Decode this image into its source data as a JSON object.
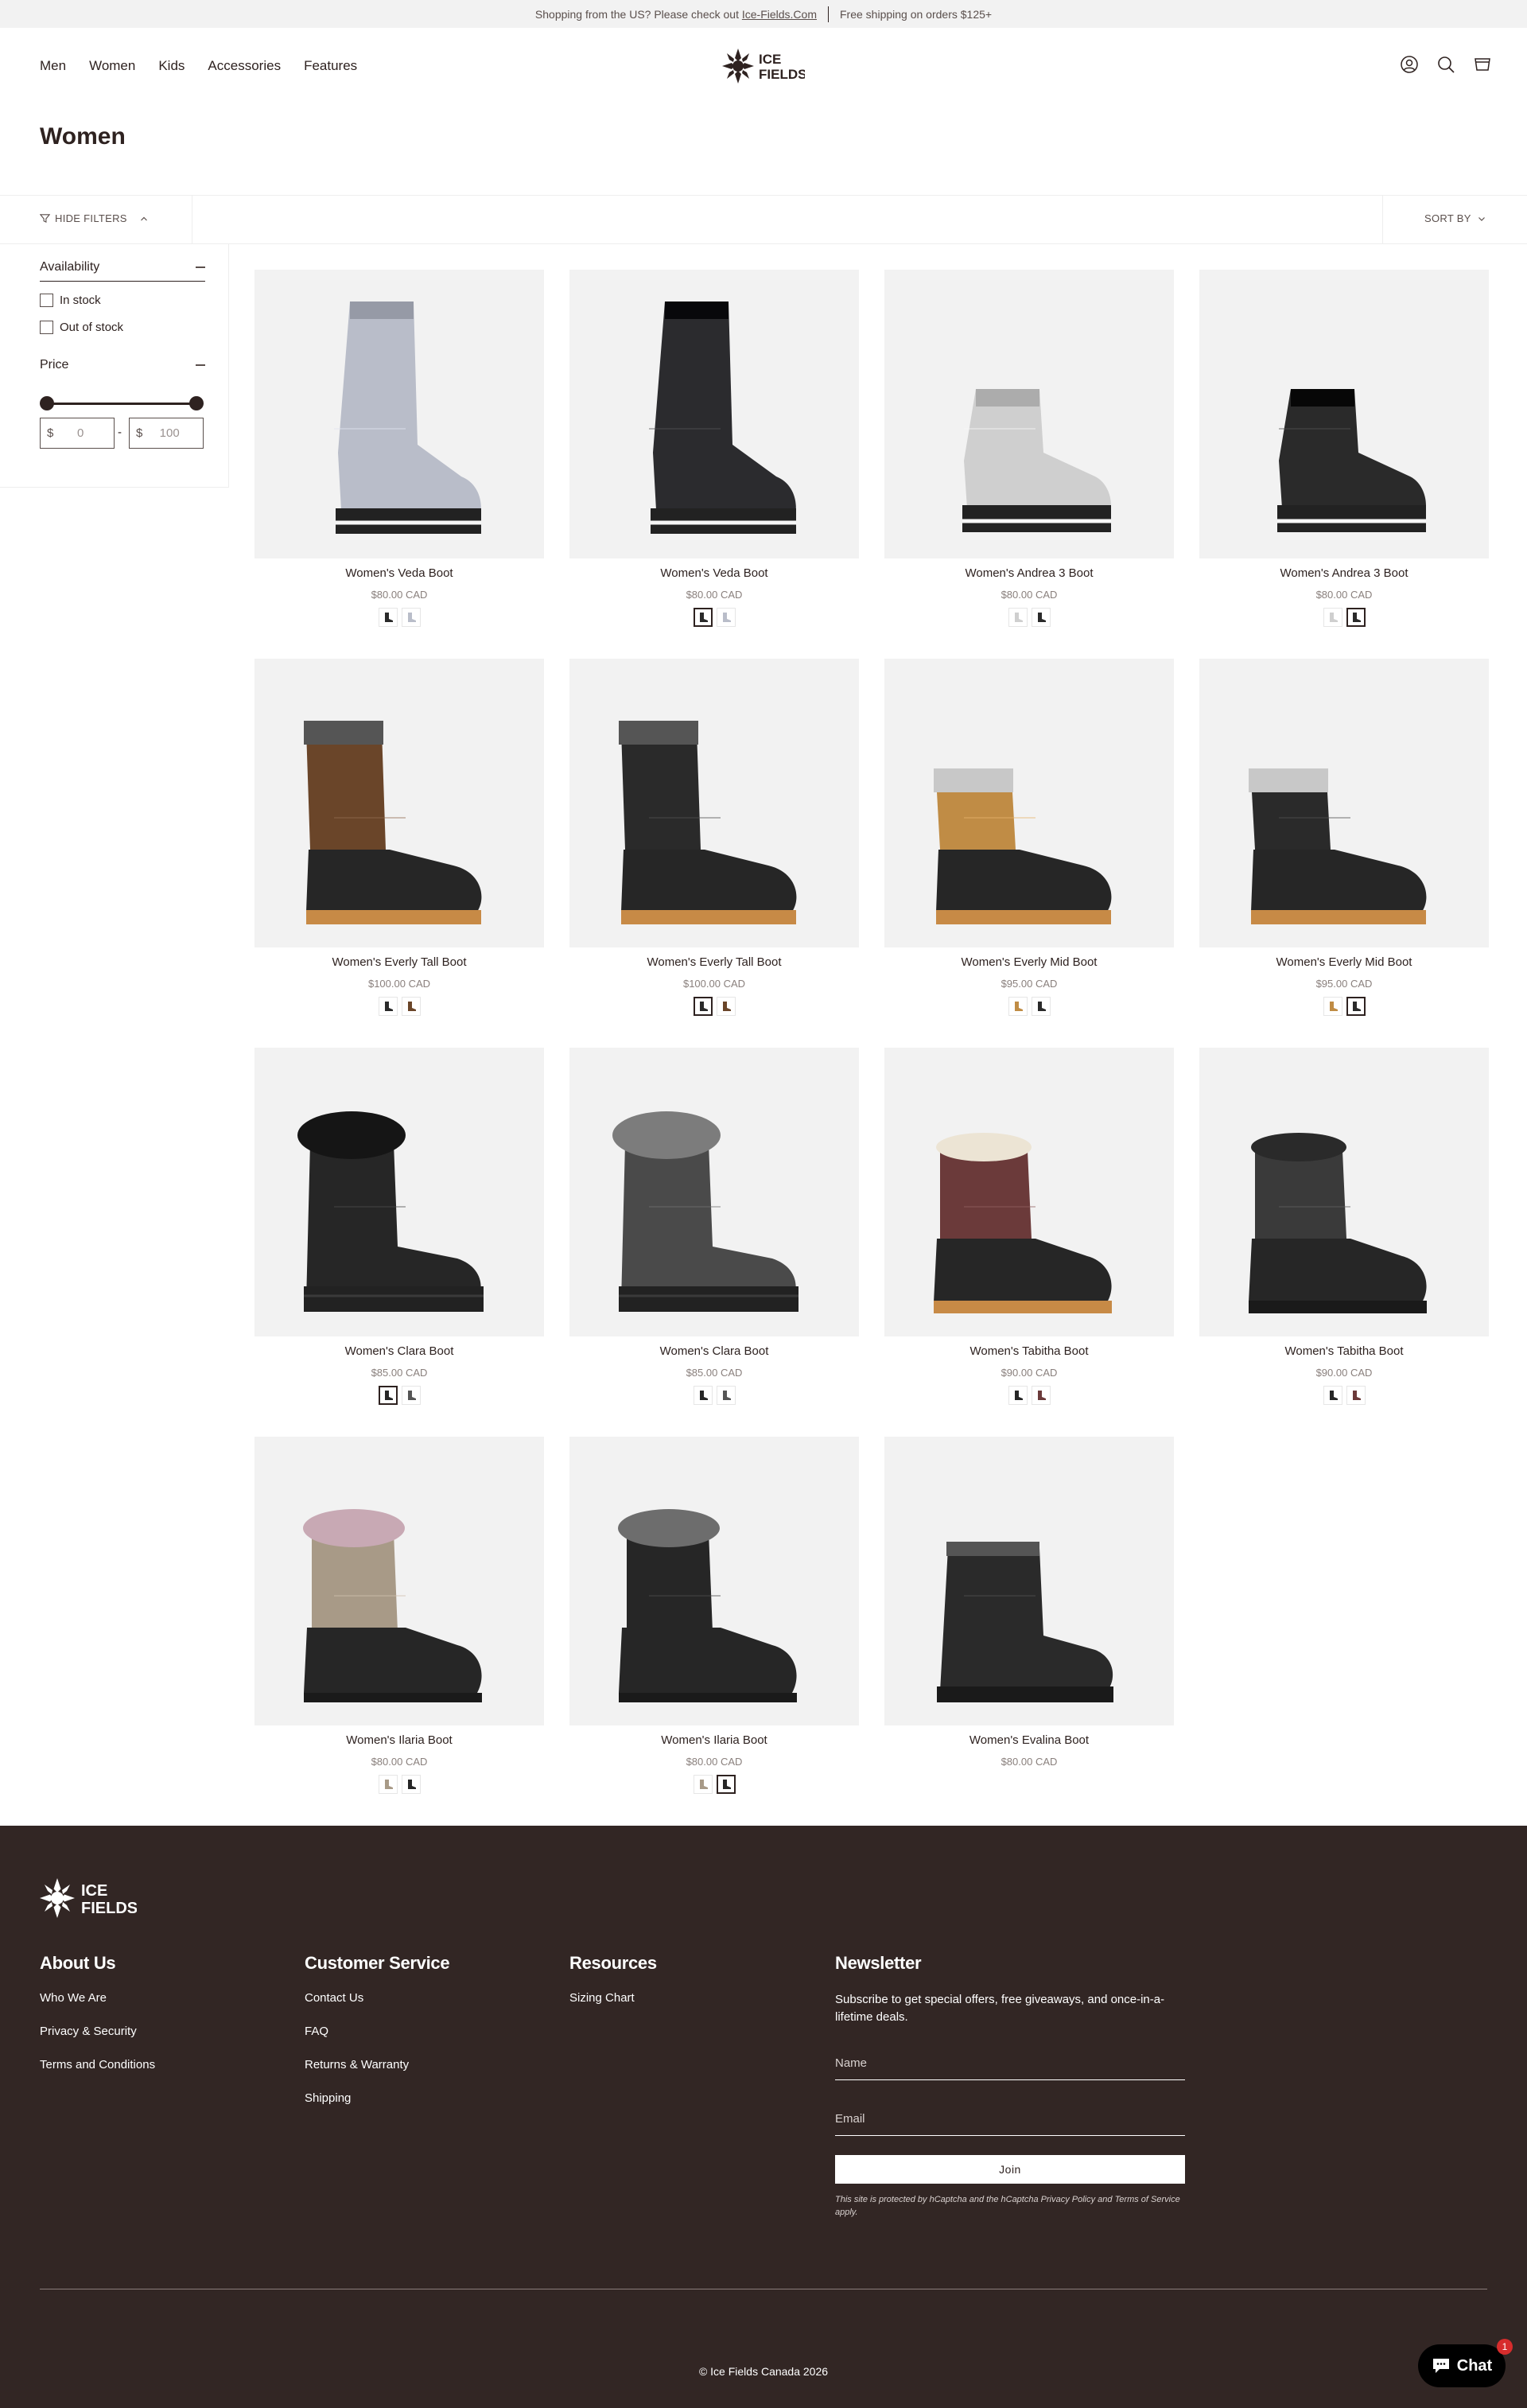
{
  "announcement": {
    "prefix": "Shopping from the US? Please check out",
    "link": "Ice-Fields.Com",
    "shipping": "Free shipping on orders $125+"
  },
  "nav": {
    "items": [
      {
        "label": "Men"
      },
      {
        "label": "Women"
      },
      {
        "label": "Kids"
      },
      {
        "label": "Accessories"
      },
      {
        "label": "Features"
      }
    ],
    "logo_text_1": "ICE",
    "logo_text_2": "FIELDS"
  },
  "page": {
    "title": "Women"
  },
  "toolbar": {
    "hide_filters": "HIDE FILTERS",
    "sort_by": "SORT BY"
  },
  "filters": {
    "availability": {
      "label": "Availability",
      "options": [
        {
          "label": "In stock"
        },
        {
          "label": "Out of stock"
        }
      ]
    },
    "price": {
      "label": "Price",
      "currency": "$",
      "min_placeholder": "0",
      "max_placeholder": "100",
      "range_low_fraction": 0,
      "range_high_fraction": 1
    }
  },
  "products": [
    {
      "name": "Women's Veda Boot",
      "price": "$80.00 CAD",
      "color": "#b9bdc9",
      "style": "tall",
      "swatches": [
        "#2a2a2a",
        "#b9bdc9"
      ],
      "active": -1
    },
    {
      "name": "Women's Veda Boot",
      "price": "$80.00 CAD",
      "color": "#2b2b2e",
      "style": "tall",
      "swatches": [
        "#2a2a2a",
        "#b9bdc9"
      ],
      "active": 0
    },
    {
      "name": "Women's Andrea 3 Boot",
      "price": "$80.00 CAD",
      "color": "#cfcfcf",
      "style": "short",
      "swatches": [
        "#cfcfcf",
        "#2a2a2a"
      ],
      "active": -1
    },
    {
      "name": "Women's Andrea 3 Boot",
      "price": "$80.00 CAD",
      "color": "#2a2a2a",
      "style": "short",
      "swatches": [
        "#cfcfcf",
        "#2a2a2a"
      ],
      "active": 1
    },
    {
      "name": "Women's Everly Tall Boot",
      "price": "$100.00 CAD",
      "color": "#6a4529",
      "style": "duck",
      "swatches": [
        "#2a2a2a",
        "#6a4529"
      ],
      "active": -1
    },
    {
      "name": "Women's Everly Tall Boot",
      "price": "$100.00 CAD",
      "color": "#2a2a2a",
      "style": "duck",
      "swatches": [
        "#2a2a2a",
        "#6a4529"
      ],
      "active": 0
    },
    {
      "name": "Women's Everly Mid Boot",
      "price": "$95.00 CAD",
      "color": "#c08c45",
      "style": "duckmid",
      "swatches": [
        "#c08c45",
        "#2a2a2a"
      ],
      "active": -1
    },
    {
      "name": "Women's Everly Mid Boot",
      "price": "$95.00 CAD",
      "color": "#2a2a2a",
      "style": "duckmid",
      "swatches": [
        "#c08c45",
        "#2a2a2a"
      ],
      "active": 1
    },
    {
      "name": "Women's Clara Boot",
      "price": "$85.00 CAD",
      "color": "#262626",
      "style": "fur",
      "swatches": [
        "#262626",
        "#555555"
      ],
      "active": 0
    },
    {
      "name": "Women's Clara Boot",
      "price": "$85.00 CAD",
      "color": "#4a4a4a",
      "style": "fur",
      "swatches": [
        "#262626",
        "#555555"
      ],
      "active": -1
    },
    {
      "name": "Women's Tabitha Boot",
      "price": "$90.00 CAD",
      "color": "#6b3a3a",
      "style": "plaid",
      "swatches": [
        "#262626",
        "#6b3a3a"
      ],
      "active": -1
    },
    {
      "name": "Women's Tabitha Boot",
      "price": "$90.00 CAD",
      "color": "#3a3a3a",
      "style": "plaid",
      "swatches": [
        "#262626",
        "#6b3a3a"
      ],
      "active": -1
    },
    {
      "name": "Women's Ilaria Boot",
      "price": "$80.00 CAD",
      "color": "#a89a87",
      "style": "ilaria",
      "swatches": [
        "#a89a87",
        "#262626"
      ],
      "active": -1
    },
    {
      "name": "Women's Ilaria Boot",
      "price": "$80.00 CAD",
      "color": "#262626",
      "style": "ilaria",
      "swatches": [
        "#a89a87",
        "#262626"
      ],
      "active": 1
    },
    {
      "name": "Women's Evalina Boot",
      "price": "$80.00 CAD",
      "color": "#2a2a2a",
      "style": "evalina",
      "swatches": [],
      "active": -1
    }
  ],
  "footer": {
    "logo_text_1": "ICE",
    "logo_text_2": "FIELDS",
    "about": {
      "heading": "About Us",
      "links": [
        "Who We Are",
        "Privacy & Security",
        "Terms and Conditions"
      ]
    },
    "service": {
      "heading": "Customer Service",
      "links": [
        "Contact Us",
        "FAQ",
        "Returns & Warranty",
        "Shipping"
      ]
    },
    "resources": {
      "heading": "Resources",
      "links": [
        "Sizing Chart"
      ]
    },
    "newsletter": {
      "heading": "Newsletter",
      "text": "Subscribe to get special offers, free giveaways, and once-in-a-lifetime deals.",
      "name_placeholder": "Name",
      "email_placeholder": "Email",
      "button": "Join",
      "legal": "This site is protected by hCaptcha and the hCaptcha Privacy Policy and Terms of Service apply."
    },
    "copyright": "© Ice Fields Canada 2026"
  },
  "chat": {
    "label": "Chat",
    "badge": "1"
  },
  "colors": {
    "brand_dark": "#322624",
    "text": "#2e2220",
    "muted": "#8a807d",
    "tile_bg": "#f2f2f2"
  }
}
